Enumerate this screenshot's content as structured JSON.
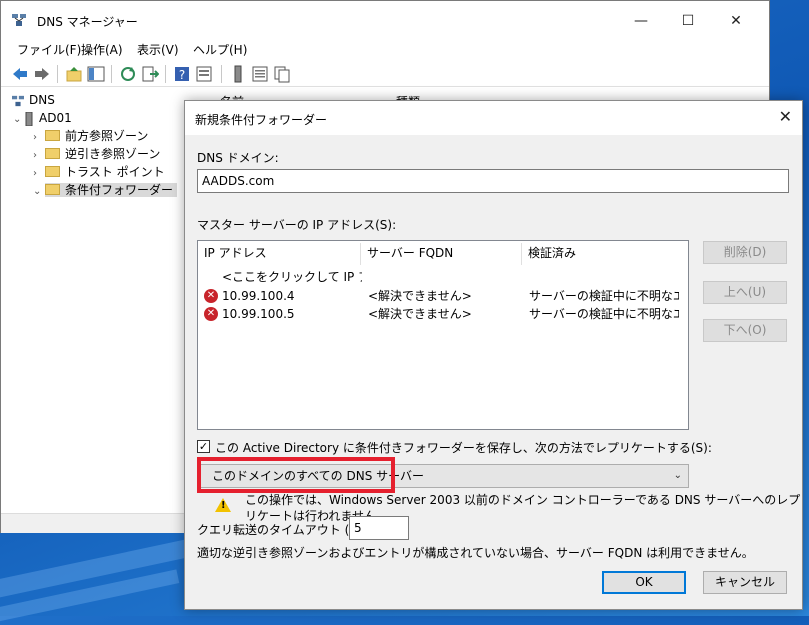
{
  "main": {
    "title": "DNS マネージャー",
    "window_controls": {
      "minimize": "—",
      "maximize": "☐",
      "close": "✕"
    },
    "menu": [
      "ファイル(F)",
      "操作(A)",
      "表示(V)",
      "ヘルプ(H)"
    ],
    "tree": {
      "root": "DNS",
      "server": "AD01",
      "children": [
        "前方参照ゾーン",
        "逆引き参照ゾーン",
        "トラスト ポイント",
        "条件付フォワーダー"
      ]
    },
    "list_headers": [
      "名前",
      "種類"
    ]
  },
  "dialog": {
    "title": "新規条件付フォワーダー",
    "close": "✕",
    "dns_domain_label": "DNS ドメイン:",
    "dns_domain_value": "AADDS.com",
    "master_label": "マスター サーバーの IP アドレス(S):",
    "columns": [
      "IP アドレス",
      "サーバー FQDN",
      "検証済み"
    ],
    "placeholder_row": "<ここをクリックして IP アドレ...",
    "rows": [
      {
        "ip": "10.99.100.4",
        "fqdn": "<解決できません>",
        "status": "サーバーの検証中に不明なエ..."
      },
      {
        "ip": "10.99.100.5",
        "fqdn": "<解決できません>",
        "status": "サーバーの検証中に不明なエ..."
      }
    ],
    "side_buttons": {
      "delete": "削除(D)",
      "up": "上へ(U)",
      "down": "下へ(O)"
    },
    "replicate_label": "この Active Directory に条件付きフォワーダーを保存し、次の方法でレプリケートする(S):",
    "replicate_checked": "✓",
    "scope_selected": "このドメインのすべての DNS サーバー",
    "warning_line1": "この操作では、Windows Server 2003 以前のドメイン コントローラーである DNS サーバーへのレプ",
    "warning_line2": "リケートは行われません。",
    "timeout_label": "クエリ転送のタイムアウト (秒):",
    "timeout_value": "5",
    "note": "適切な逆引き参照ゾーンおよびエントリが構成されていない場合、サーバー FQDN は利用できません。",
    "ok": "OK",
    "cancel": "キャンセル"
  },
  "colors": {
    "highlight": "#e5202e",
    "error": "#c8242b",
    "accent": "#0078d7"
  }
}
